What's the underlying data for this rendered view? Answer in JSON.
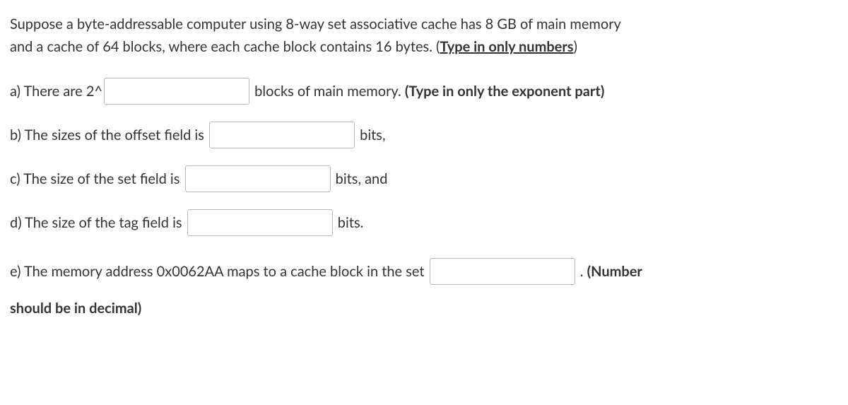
{
  "intro": {
    "line1": "Suppose a byte-addressable computer using 8-way set associative cache has 8 GB of main memory",
    "line2a": "and a cache of 64 blocks, where each cache block contains 16 bytes. (",
    "line2_underline": "Type in only numbers",
    "line2b": ")"
  },
  "qa": {
    "pre": "a) There are 2^",
    "post_plain": " blocks of main memory. ",
    "post_bold": "(Type in only the exponent part)"
  },
  "qb": {
    "pre": "b) The sizes of the offset field is ",
    "post": " bits,"
  },
  "qc": {
    "pre": "c) The size of the set field is ",
    "post": " bits, and"
  },
  "qd": {
    "pre": "d) The size of the tag field is ",
    "post": " bits."
  },
  "qe": {
    "pre": "e) The memory address 0x0062AA maps to a cache block in the set ",
    "post_plain": " . ",
    "post_bold1": "(Number",
    "post_bold2": "should be in decimal)"
  }
}
